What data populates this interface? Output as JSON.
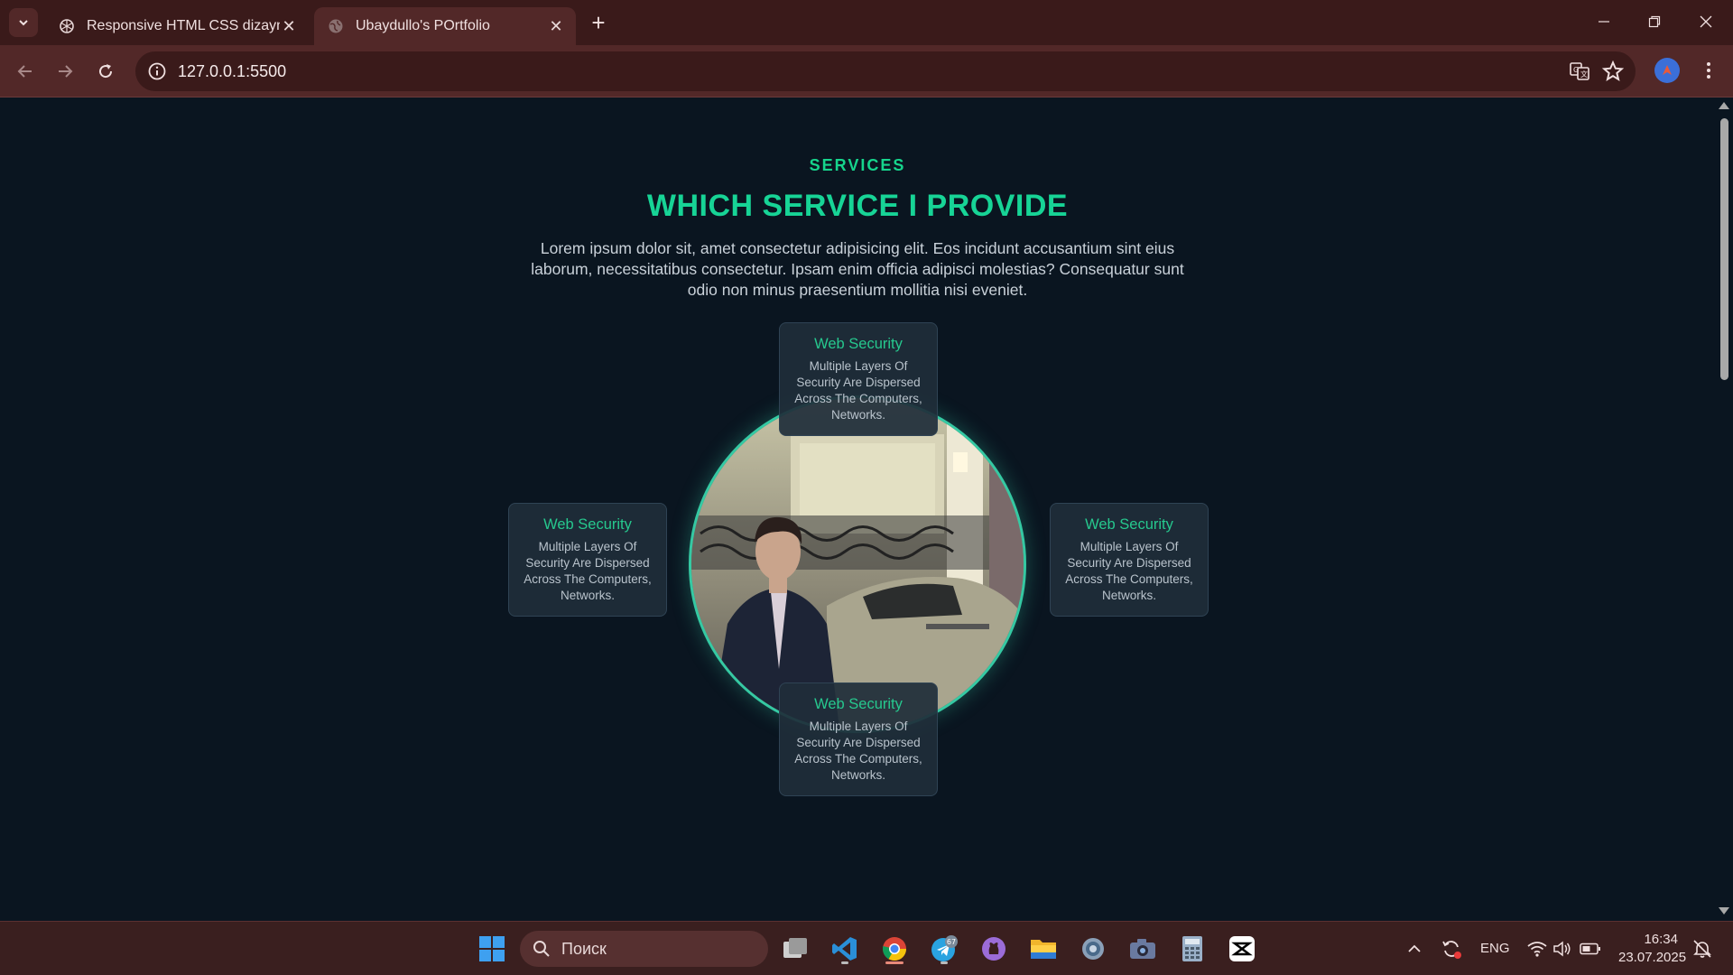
{
  "browser": {
    "tabs": [
      {
        "title": "Responsive HTML CSS dizayn",
        "active": false
      },
      {
        "title": "Ubaydullo's POrtfolio",
        "active": true
      }
    ],
    "url": "127.0.0.1:5500"
  },
  "page": {
    "eyebrow": "SERVICES",
    "heading": "WHICH SERVICE I PROVIDE",
    "lead": "Lorem ipsum dolor sit, amet consectetur adipisicing elit. Eos incidunt accusantium sint eius laborum, necessitatibus consectetur. Ipsam enim officia adipisci molestias? Consequatur sunt odio non minus praesentium mollitia nisi eveniet.",
    "cards": [
      {
        "position": "top",
        "title": "Web Security",
        "desc": "Multiple Layers Of Security Are Dispersed Across The Computers, Networks."
      },
      {
        "position": "left",
        "title": "Web Security",
        "desc": "Multiple Layers Of Security Are Dispersed Across The Computers, Networks."
      },
      {
        "position": "right",
        "title": "Web Security",
        "desc": "Multiple Layers Of Security Are Dispersed Across The Computers, Networks."
      },
      {
        "position": "bottom",
        "title": "Web Security",
        "desc": "Multiple Layers Of Security Are Dispersed Across The Computers, Networks."
      }
    ],
    "accent": "#17d496"
  },
  "taskbar": {
    "search_placeholder": "Поиск",
    "telegram_badge": "67",
    "language": "ENG",
    "time": "16:34",
    "date": "23.07.2025"
  }
}
